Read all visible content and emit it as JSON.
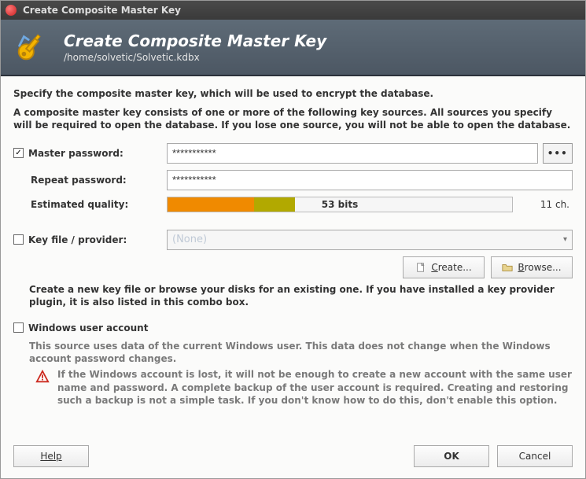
{
  "titlebar": {
    "title": "Create Composite Master Key"
  },
  "header": {
    "title": "Create Composite Master Key",
    "path": "/home/solvetic/Solvetic.kdbx"
  },
  "intro1": "Specify the composite master key, which will be used to encrypt the database.",
  "intro2": "A composite master key consists of one or more of the following key sources. All sources you specify will be required to open the database.  If you lose one source, you will not be able to open the database.",
  "master": {
    "label": "Master password:",
    "value": "***********",
    "repeat_label": "Repeat password:",
    "repeat_value": "***********",
    "quality_label": "Estimated quality:",
    "quality_text": "53 bits",
    "char_count": "11 ch.",
    "dots": "•••"
  },
  "keyfile": {
    "label": "Key file / provider:",
    "combo_value": "(None)",
    "create_btn": "Create...",
    "browse_btn": "Browse...",
    "desc": "Create a new key file or browse your disks for an existing one. If you have installed a key provider plugin, it is also listed in this combo box."
  },
  "winacct": {
    "label": "Windows user account",
    "desc": "This source uses data of the current Windows user. This data does not change when the Windows account password changes.",
    "warn": "If the Windows account is lost, it will not be enough to create a new account with the same user name and password. A complete backup of the user account is required. Creating and restoring such a backup is not a simple task. If you don't know how to do this, don't enable this option."
  },
  "footer": {
    "help": "Help",
    "ok": "OK",
    "cancel": "Cancel"
  }
}
